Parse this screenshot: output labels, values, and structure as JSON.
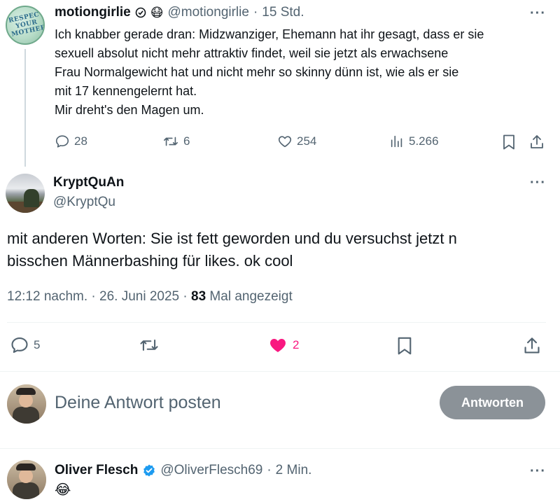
{
  "tweet1": {
    "display_name": "motiongirlie",
    "handle": "@motiongirlie",
    "time": "15 Std.",
    "text_lines": [
      "Ich knabber gerade dran: Midzwanziger, Ehemann hat ihr gesagt, dass er sie",
      "sexuell absolut nicht mehr attraktiv findet, weil sie jetzt als erwachsene",
      "Frau Normalgewicht hat und nicht mehr so skinny dünn ist, wie als er sie",
      "mit 17 kennengelernt hat.",
      "Mir dreht's den Magen um."
    ],
    "replies": "28",
    "reposts": "6",
    "likes": "254",
    "views": "5.266",
    "avatar_text": "RESPECT YOUR MOTHER",
    "emoji": "😷"
  },
  "tweet2": {
    "display_name": "KryptQuAn",
    "handle": "@KryptQu",
    "text_lines": [
      "mit anderen Worten: Sie ist fett geworden und du versuchst jetzt n",
      "bisschen Männerbashing für likes. ok cool"
    ],
    "timestamp": "12:12 nachm. · 26. Juni 2025 ·",
    "views_count": "83",
    "views_label": "Mal angezeigt",
    "replies": "5",
    "likes": "2",
    "like_color": "#f91880"
  },
  "reply_bar": {
    "placeholder": "Deine Antwort posten",
    "button_label": "Antworten"
  },
  "tweet3": {
    "display_name": "Oliver Flesch",
    "handle": "@OliverFlesch69",
    "time": "2 Min.",
    "text": "😂",
    "verified_color": "#1d9bf0"
  },
  "separator": "·",
  "more_label": "···"
}
